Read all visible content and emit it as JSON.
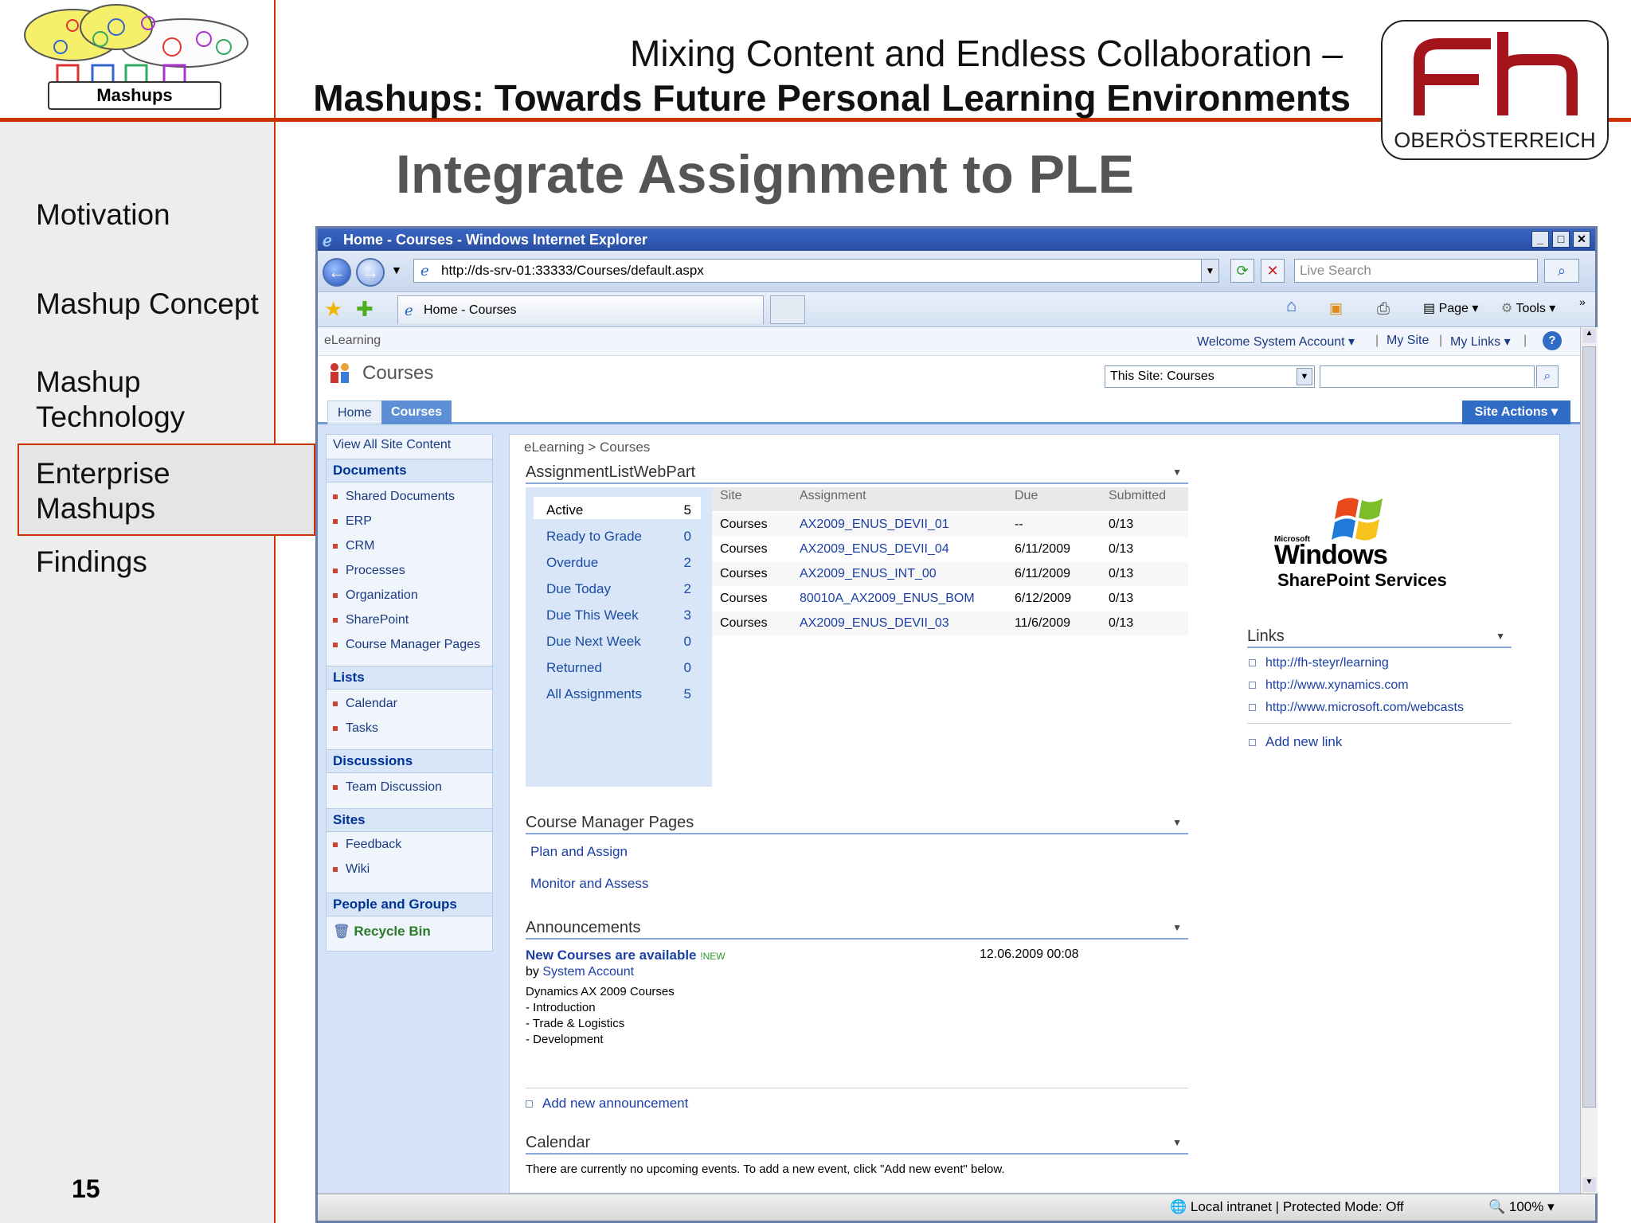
{
  "slide": {
    "logo_label": "Mashups",
    "title_line1": "Mixing Content and Endless Collaboration –",
    "title_line2": "Mashups: Towards Future Personal Learning Environments",
    "institution": "OBERÖSTERREICH",
    "heading": "Integrate Assignment to PLE",
    "page_number": "15",
    "nav": [
      "Motivation",
      "Mashup Concept",
      "Mashup Technology",
      "Enterprise Mashups",
      "Findings"
    ],
    "nav_active": "Enterprise Mashups",
    "accent_color": "#cc3300"
  },
  "browser": {
    "window_title": "Home - Courses - Windows Internet Explorer",
    "address": "http://ds-srv-01:33333/Courses/default.aspx",
    "search_placeholder": "Live Search",
    "tab_label": "Home - Courses",
    "toolbar": {
      "page": "Page",
      "tools": "Tools"
    },
    "status": "Local intranet | Protected Mode: Off",
    "zoom": "100%"
  },
  "sharepoint": {
    "global_site": "eLearning",
    "welcome": "Welcome System Account",
    "my_site": "My Site",
    "my_links": "My Links",
    "site_title": "Courses",
    "search_scope": "This Site: Courses",
    "tabs": [
      "Home",
      "Courses"
    ],
    "active_tab": "Courses",
    "site_actions": "Site Actions",
    "breadcrumb": "eLearning > Courses",
    "quicklaunch": {
      "view_all": "View All Site Content",
      "documents_head": "Documents",
      "documents": [
        "Shared Documents",
        "ERP",
        "CRM",
        "Processes",
        "Organization",
        "SharePoint",
        "Course Manager Pages"
      ],
      "lists_head": "Lists",
      "lists": [
        "Calendar",
        "Tasks"
      ],
      "discussions_head": "Discussions",
      "discussions": [
        "Team Discussion"
      ],
      "sites_head": "Sites",
      "sites": [
        "Feedback",
        "Wiki"
      ],
      "people_head": "People and Groups",
      "recycle_bin": "Recycle Bin"
    },
    "assignment_webpart": {
      "title": "AssignmentListWebPart",
      "filters": [
        {
          "label": "Active",
          "count": "5"
        },
        {
          "label": "Ready to Grade",
          "count": "0"
        },
        {
          "label": "Overdue",
          "count": "2"
        },
        {
          "label": "Due Today",
          "count": "2"
        },
        {
          "label": "Due This Week",
          "count": "3"
        },
        {
          "label": "Due Next Week",
          "count": "0"
        },
        {
          "label": "Returned",
          "count": "0"
        },
        {
          "label": "All Assignments",
          "count": "5"
        }
      ],
      "columns": [
        "Site",
        "Assignment",
        "Due",
        "Submitted"
      ],
      "rows": [
        {
          "site": "Courses",
          "assignment": "AX2009_ENUS_DEVII_01",
          "due": "--",
          "submitted": "0/13"
        },
        {
          "site": "Courses",
          "assignment": "AX2009_ENUS_DEVII_04",
          "due": "6/11/2009",
          "submitted": "0/13"
        },
        {
          "site": "Courses",
          "assignment": "AX2009_ENUS_INT_00",
          "due": "6/11/2009",
          "submitted": "0/13"
        },
        {
          "site": "Courses",
          "assignment": "80010A_AX2009_ENUS_BOM",
          "due": "6/12/2009",
          "submitted": "0/13"
        },
        {
          "site": "Courses",
          "assignment": "AX2009_ENUS_DEVII_03",
          "due": "11/6/2009",
          "submitted": "0/13"
        }
      ]
    },
    "wss_logo": {
      "small": "Microsoft",
      "big": "Windows",
      "sub": "SharePoint Services"
    },
    "links": {
      "title": "Links",
      "items": [
        "http://fh-steyr/learning",
        "http://www.xynamics.com",
        "http://www.microsoft.com/webcasts"
      ],
      "add": "Add new link"
    },
    "course_manager": {
      "title": "Course Manager Pages",
      "items": [
        "Plan and Assign",
        "Monitor and Assess"
      ]
    },
    "announcements": {
      "title": "Announcements",
      "item_title": "New Courses are available",
      "new_badge": "NEW",
      "date": "12.06.2009 00:08",
      "by_prefix": "by",
      "author": "System Account",
      "body": [
        "Dynamics AX 2009 Courses",
        "- Introduction",
        "- Trade & Logistics",
        "- Development"
      ],
      "add": "Add new announcement"
    },
    "calendar": {
      "title": "Calendar",
      "empty_text": "There are currently no upcoming events. To add a new event, click \"Add new event\" below."
    }
  }
}
